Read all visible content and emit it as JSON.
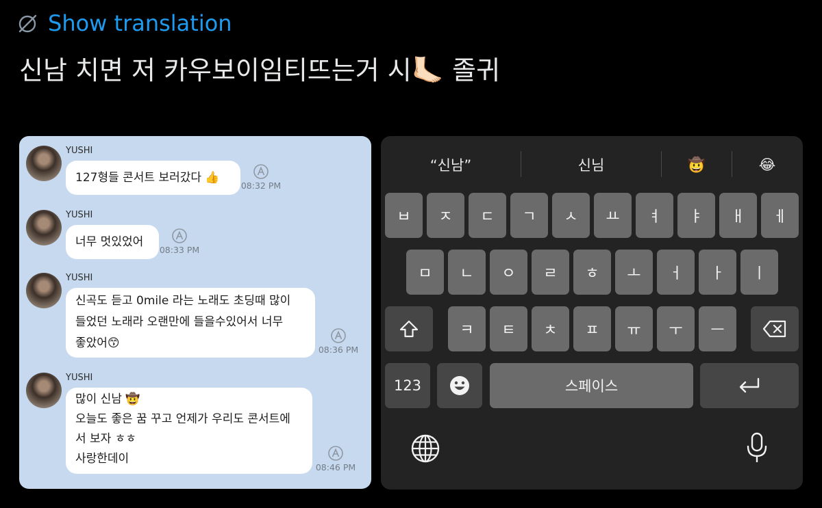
{
  "header": {
    "translate_label": "Show translation",
    "tweet_text": "신남 치면 저 카우보이임티뜨는거 시🦶🏻 졸귀"
  },
  "chat": {
    "messages": [
      {
        "sender": "YUSHI",
        "lines": [
          "127형들 콘서트 보러갔다 👍"
        ],
        "time": "08:32 PM"
      },
      {
        "sender": "YUSHI",
        "lines": [
          "너무 멋있었어"
        ],
        "time": "08:33 PM"
      },
      {
        "sender": "YUSHI",
        "lines": [
          "신곡도 듣고 0mile 라는 노래도 초딩때 많이",
          "들었던 노래라 오랜만에 들을수있어서 너무",
          "좋았어😙"
        ],
        "time": "08:36 PM"
      },
      {
        "sender": "YUSHI",
        "lines": [
          "많이 신남 🤠",
          "오늘도 좋은 꿈 꾸고 언제가 우리도 콘서트에",
          "서 보자 ㅎㅎ",
          "사랑한데이"
        ],
        "time": "08:46 PM"
      }
    ]
  },
  "keyboard": {
    "suggestions": [
      "“신남”",
      "신님",
      "🤠",
      "😂"
    ],
    "row1": [
      "ㅂ",
      "ㅈ",
      "ㄷ",
      "ㄱ",
      "ㅅ",
      "ㅛ",
      "ㅕ",
      "ㅑ",
      "ㅐ",
      "ㅔ"
    ],
    "row2": [
      "ㅁ",
      "ㄴ",
      "ㅇ",
      "ㄹ",
      "ㅎ",
      "ㅗ",
      "ㅓ",
      "ㅏ",
      "ㅣ"
    ],
    "row3": [
      "ㅋ",
      "ㅌ",
      "ㅊ",
      "ㅍ",
      "ㅠ",
      "ㅜ",
      "ㅡ"
    ],
    "numbers_key": "123",
    "space_key": "스페이스",
    "icons": {
      "shift": "shift-icon",
      "backspace": "backspace-icon",
      "emoji": "emoji-icon",
      "return": "return-icon",
      "globe": "globe-icon",
      "mic": "microphone-icon"
    }
  },
  "colors": {
    "background": "#000000",
    "link": "#1d9bf0",
    "chat_background": "#c6d9ee",
    "bubble": "#ffffff",
    "keyboard_background": "#232323",
    "letter_key": "#6b6b6b",
    "function_key": "#464646"
  }
}
